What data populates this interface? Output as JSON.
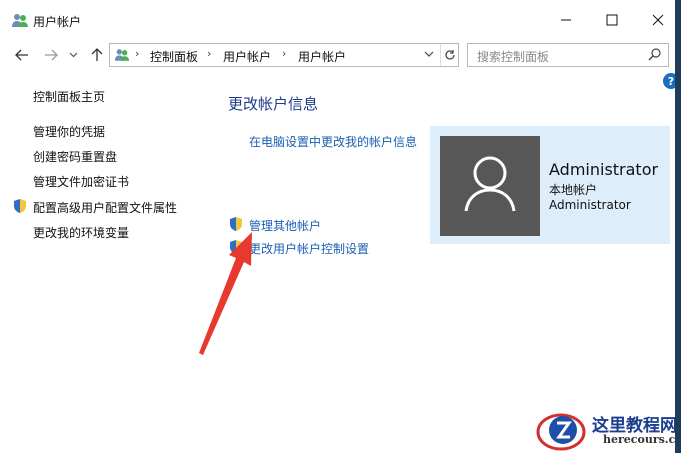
{
  "window": {
    "title": "用户帐户"
  },
  "nav": {
    "breadcrumbs": [
      "控制面板",
      "用户帐户",
      "用户帐户"
    ],
    "search_placeholder": "搜索控制面板",
    "help": "?"
  },
  "sidebar": {
    "items": [
      {
        "label": "控制面板主页"
      },
      {
        "label": "管理你的凭据"
      },
      {
        "label": "创建密码重置盘"
      },
      {
        "label": "管理文件加密证书"
      },
      {
        "label": "配置高级用户配置文件属性"
      },
      {
        "label": "更改我的环境变量"
      }
    ]
  },
  "main": {
    "title": "更改帐户信息",
    "pc_settings_link": "在电脑设置中更改我的帐户信息",
    "manage_other_link": "管理其他帐户",
    "uac_link": "更改用户帐户控制设置"
  },
  "account": {
    "name": "Administrator",
    "type": "本地帐户",
    "group": "Administrator"
  },
  "watermark": {
    "name": "这里教程网",
    "url": "herecours.com"
  },
  "colors": {
    "link": "#1a5fb4",
    "title": "#1e3a8a",
    "card_bg": "#ddeefa",
    "arrow": "#e8392f"
  }
}
